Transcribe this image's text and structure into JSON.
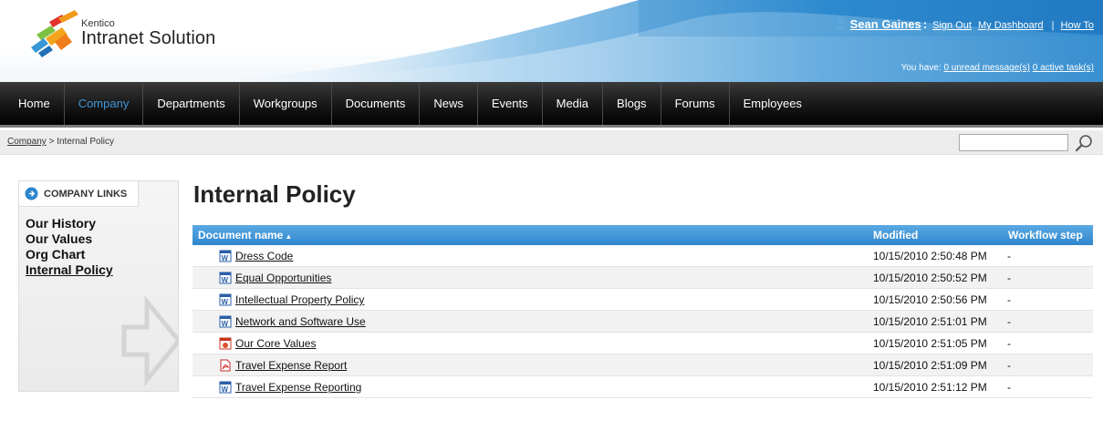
{
  "logo": {
    "small": "Kentico",
    "big": "Intranet Solution"
  },
  "user": {
    "name": "Sean Gaines",
    "sign_out": "Sign Out",
    "dashboard": "My Dashboard",
    "separator": "|",
    "howto": "How To"
  },
  "activity": {
    "prefix": "You have:",
    "messages": "0 unread message(s)",
    "tasks": "0 active task(s)"
  },
  "menu": [
    "Home",
    "Company",
    "Departments",
    "Workgroups",
    "Documents",
    "News",
    "Events",
    "Media",
    "Blogs",
    "Forums",
    "Employees"
  ],
  "menu_active": "Company",
  "breadcrumb": {
    "parent": "Company",
    "separator": ">",
    "current": "Internal Policy"
  },
  "search": {
    "value": ""
  },
  "sidebar": {
    "tab_label": "COMPANY LINKS",
    "links": [
      "Our History",
      "Our Values",
      "Org Chart",
      "Internal Policy"
    ],
    "current": "Internal Policy"
  },
  "main": {
    "title": "Internal Policy"
  },
  "grid": {
    "headers": {
      "document_name": "Document name",
      "modified": "Modified",
      "workflow": "Workflow step"
    },
    "rows": [
      {
        "name": "Dress Code",
        "icon": "word-doc-icon",
        "modified": "10/15/2010 2:50:48 PM",
        "workflow": "-"
      },
      {
        "name": "Equal Opportunities",
        "icon": "word-doc-icon",
        "modified": "10/15/2010 2:50:52 PM",
        "workflow": "-"
      },
      {
        "name": "Intellectual Property Policy",
        "icon": "word-doc-icon",
        "modified": "10/15/2010 2:50:56 PM",
        "workflow": "-"
      },
      {
        "name": "Network and Software Use",
        "icon": "word-doc-icon",
        "modified": "10/15/2010 2:51:01 PM",
        "workflow": "-"
      },
      {
        "name": "Our Core Values",
        "icon": "powerpoint-icon",
        "modified": "10/15/2010 2:51:05 PM",
        "workflow": "-"
      },
      {
        "name": "Travel Expense Report",
        "icon": "pdf-icon",
        "modified": "10/15/2010 2:51:09 PM",
        "workflow": "-"
      },
      {
        "name": "Travel Expense Reporting",
        "icon": "word-doc-icon",
        "modified": "10/15/2010 2:51:12 PM",
        "workflow": "-"
      }
    ]
  }
}
